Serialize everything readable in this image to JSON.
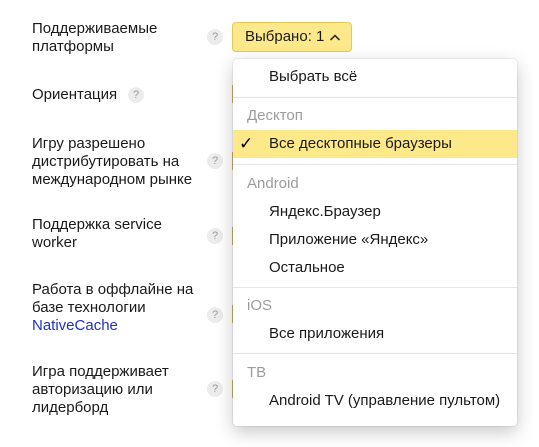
{
  "settings": {
    "platforms_label": "Поддерживаемые платформы",
    "orientation_label": "Ориентация",
    "international_label": "Игру разрешено дистрибутировать на международном рынке",
    "service_worker_label": "Поддержка service worker",
    "offline_label_prefix": "Работа в оффлайне на базе технологии",
    "offline_link": "NativeCache",
    "leaderboard_label": "Игра поддерживает авторизацию или лидерборд",
    "help_glyph": "?"
  },
  "select": {
    "value": "Выбрано: 1",
    "chevron": "^",
    "accent_color": "#fde98a"
  },
  "dropdown": {
    "select_all": "Выбрать всё",
    "groups": [
      {
        "title": "Десктоп",
        "items": [
          {
            "label": "Все десктопные браузеры",
            "selected": true
          }
        ]
      },
      {
        "title": "Android",
        "items": [
          {
            "label": "Яндекс.Браузер",
            "selected": false
          },
          {
            "label": "Приложение «Яндекс»",
            "selected": false
          },
          {
            "label": "Остальное",
            "selected": false
          }
        ]
      },
      {
        "title": "iOS",
        "items": [
          {
            "label": "Все приложения",
            "selected": false
          }
        ]
      },
      {
        "title": "ТВ",
        "items": [
          {
            "label": "Android TV (управление пультом)",
            "selected": false
          }
        ]
      }
    ],
    "check_glyph": "✓"
  }
}
